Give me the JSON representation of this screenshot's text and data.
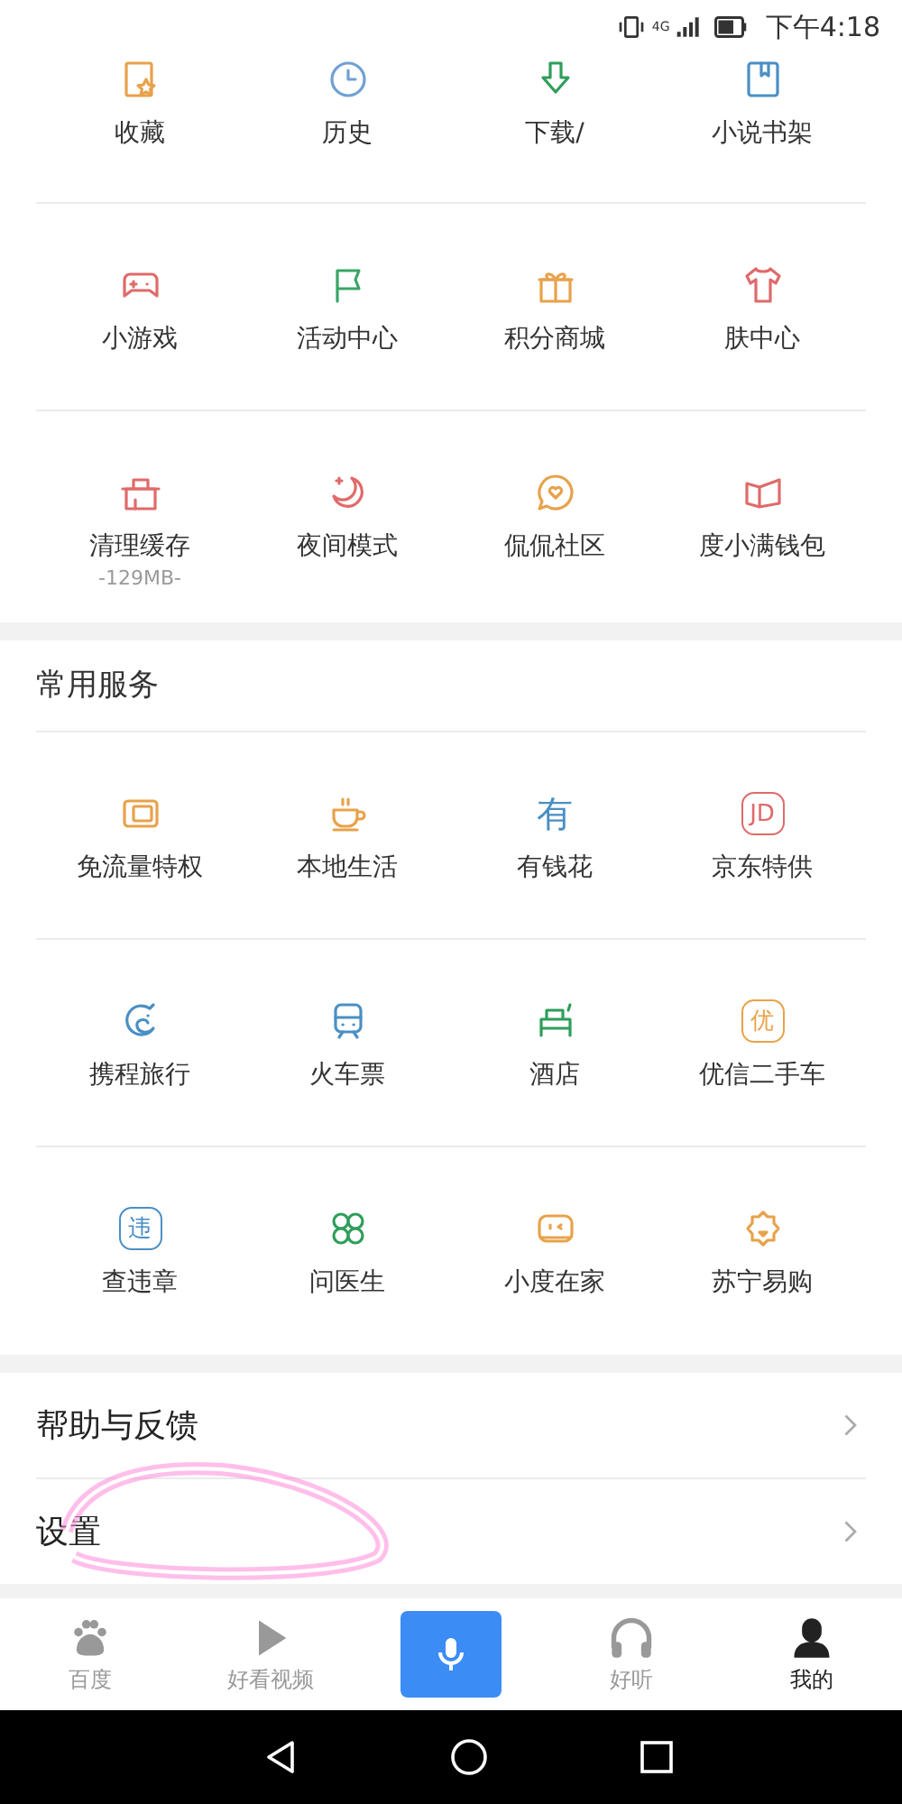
{
  "status_bar": {
    "network": "4G",
    "time": "下午4:18"
  },
  "tools": {
    "rows": [
      [
        {
          "label": "收藏"
        },
        {
          "label": "历史"
        },
        {
          "label": "下载/"
        },
        {
          "label": "小说书架"
        }
      ],
      [
        {
          "label": "小游戏"
        },
        {
          "label": "活动中心"
        },
        {
          "label": "积分商城"
        },
        {
          "label": "肤中心"
        }
      ],
      [
        {
          "label": "清理缓存",
          "sub": "-129MB-"
        },
        {
          "label": "夜间模式"
        },
        {
          "label": "侃侃社区"
        },
        {
          "label": "度小满钱包"
        }
      ]
    ]
  },
  "services": {
    "title": "常用服务",
    "rows": [
      [
        {
          "label": "免流量特权"
        },
        {
          "label": "本地生活"
        },
        {
          "label": "有钱花",
          "icon_text": "有"
        },
        {
          "label": "京东特供",
          "icon_text": "JD"
        }
      ],
      [
        {
          "label": "携程旅行"
        },
        {
          "label": "火车票"
        },
        {
          "label": "酒店"
        },
        {
          "label": "优信二手车",
          "icon_text": "优"
        }
      ],
      [
        {
          "label": "查违章",
          "icon_text": "违"
        },
        {
          "label": "问医生"
        },
        {
          "label": "小度在家"
        },
        {
          "label": "苏宁易购"
        }
      ]
    ]
  },
  "menu": [
    {
      "label": "帮助与反馈"
    },
    {
      "label": "设置"
    }
  ],
  "highlight": {
    "kind": "ring"
  },
  "tab_bar": [
    {
      "kind": "tab",
      "label": "百度",
      "selected": false
    },
    {
      "kind": "tab",
      "label": "好看视频",
      "selected": false
    },
    {
      "kind": "voice"
    },
    {
      "kind": "tab",
      "label": "好听",
      "selected": false
    },
    {
      "kind": "tab",
      "label": "我的",
      "selected": true
    }
  ]
}
